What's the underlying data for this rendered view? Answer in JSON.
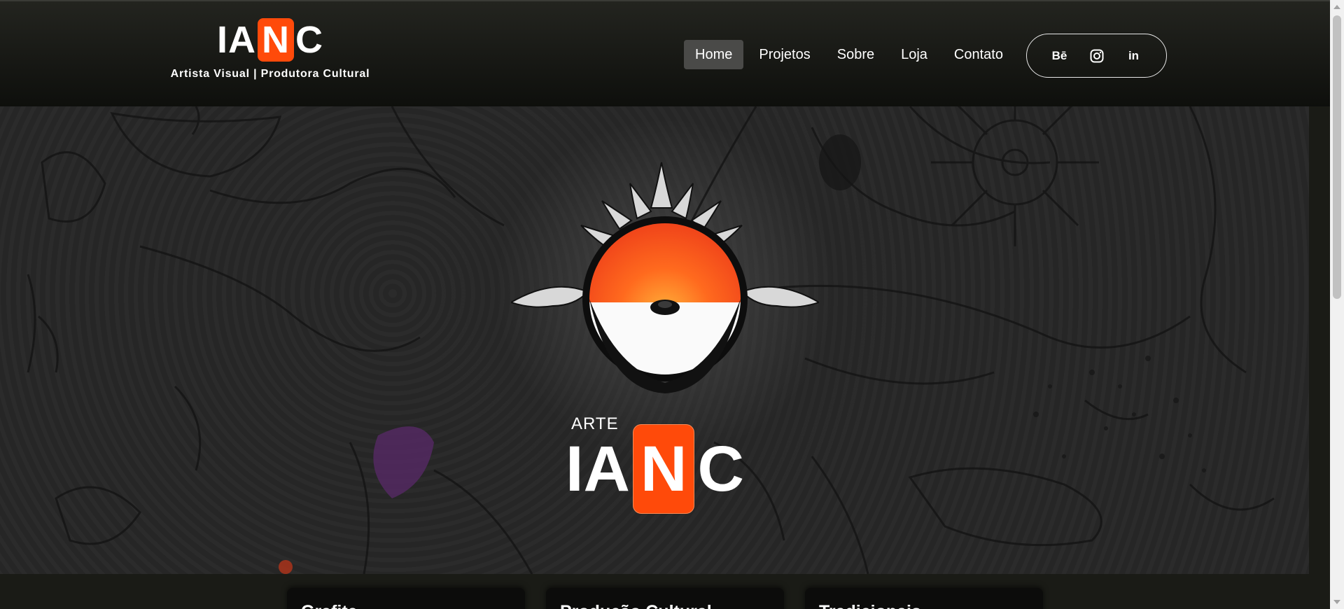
{
  "header": {
    "logo": {
      "part1": "IA",
      "highlight": "N",
      "part2": "C"
    },
    "tagline": "Artista Visual | Produtora Cultural"
  },
  "nav": {
    "items": [
      {
        "label": "Home",
        "active": true
      },
      {
        "label": "Projetos"
      },
      {
        "label": "Sobre"
      },
      {
        "label": "Loja"
      },
      {
        "label": "Contato"
      }
    ]
  },
  "social": {
    "items": [
      {
        "icon": "behance-icon",
        "glyph": "Bē"
      },
      {
        "icon": "instagram-icon"
      },
      {
        "icon": "linkedin-icon",
        "glyph": "in"
      }
    ]
  },
  "hero": {
    "brand_prefix": "ARTE",
    "brand": {
      "part1": "IA",
      "highlight": "N",
      "part2": "C"
    }
  },
  "cards": [
    {
      "title": "Grafite"
    },
    {
      "title": "Produção Cultural"
    },
    {
      "title": "Tradicionais"
    }
  ],
  "colors": {
    "accent": "#ff4a0a",
    "header": "#15160f",
    "background": "#1a1b16"
  }
}
